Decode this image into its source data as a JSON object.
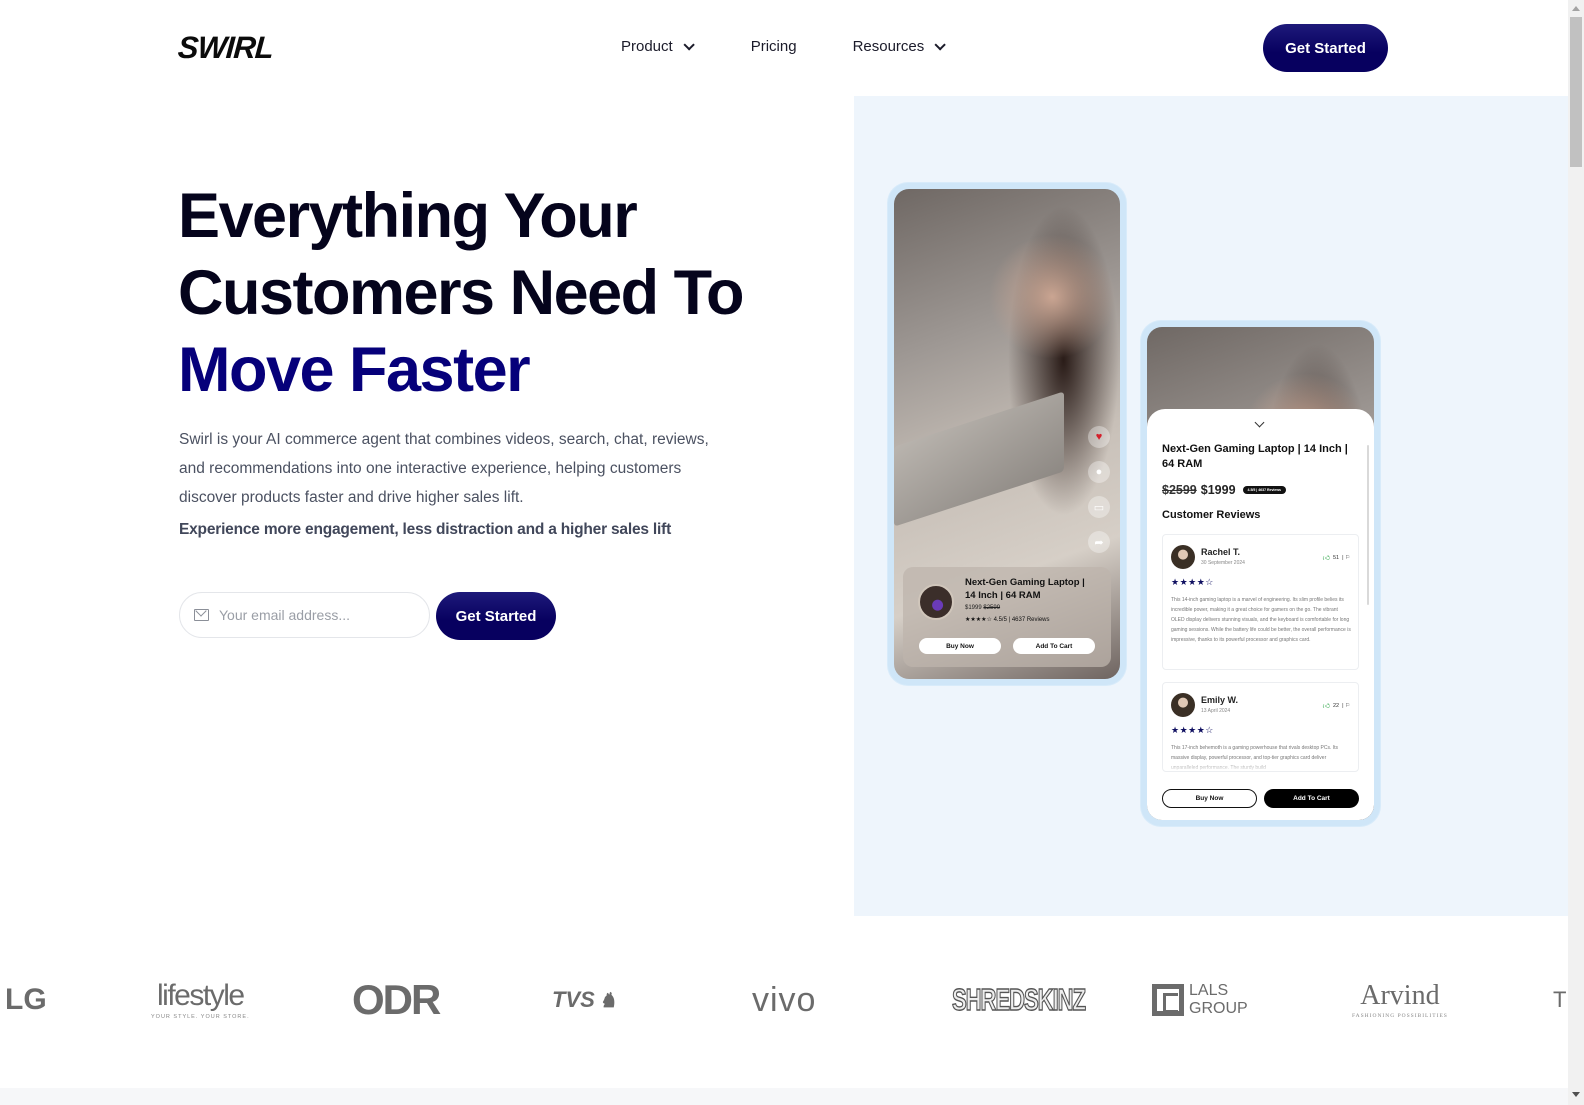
{
  "header": {
    "logo": "SWIRL",
    "nav": [
      {
        "label": "Product",
        "has_dropdown": true
      },
      {
        "label": "Pricing",
        "has_dropdown": false
      },
      {
        "label": "Resources",
        "has_dropdown": true
      }
    ],
    "cta_label": "Get Started"
  },
  "hero": {
    "title_line1": "Everything Your",
    "title_line2": "Customers Need To",
    "title_accent": "Move Faster",
    "description": "Swirl is your AI commerce agent that combines videos, search, chat, reviews, and recommendations into one interactive experience, helping customers discover products faster and drive higher sales lift.",
    "emphasis": "Experience more engagement, less distraction and a higher sales lift",
    "email_placeholder": "Your email address...",
    "email_value": "",
    "cta_label": "Get Started"
  },
  "video_phone": {
    "side_actions": [
      "heart-icon",
      "chat-icon",
      "bag-icon",
      "share-icon"
    ],
    "product": {
      "title": "Next-Gen Gaming Laptop | 14 Inch | 64 RAM",
      "price": "$1999",
      "old_price": "$2599",
      "stars": "★★★★☆",
      "rating_text": "4.5/5 | 4637 Reviews",
      "buy_label": "Buy Now",
      "cart_label": "Add To Cart"
    }
  },
  "review_phone": {
    "title": "Next-Gen Gaming Laptop | 14 Inch | 64 RAM",
    "old_price": "$2599",
    "price": "$1999",
    "rating_badge": "4.5/5 | 4637 Reviews",
    "section_title": "Customer Reviews",
    "reviews": [
      {
        "name": "Rachel T.",
        "date": "30 September 2024",
        "likes": "51",
        "stars": "★★★★☆",
        "text": "This 14-inch gaming laptop is a marvel of engineering. Its slim profile belies its incredible power, making it a great choice for gamers on the go. The vibrant OLED display delivers stunning visuals, and the keyboard is comfortable for long gaming sessions. While the battery life could be better, the overall performance is impressive, thanks to its powerful processor and graphics card."
      },
      {
        "name": "Emily W.",
        "date": "13 April 2024",
        "likes": "22",
        "stars": "★★★★☆",
        "text": "This 17-inch behemoth is a gaming powerhouse that rivals desktop PCs. Its massive display, powerful processor, and top-tier graphics card deliver unparalleled performance. The sturdy build"
      }
    ],
    "buy_label": "Buy Now",
    "cart_label": "Add To Cart"
  },
  "brands": [
    {
      "name": "LG"
    },
    {
      "name": "lifestyle",
      "tagline": "YOUR STYLE. YOUR STORE."
    },
    {
      "name": "ODR"
    },
    {
      "name": "TVS"
    },
    {
      "name": "vivo"
    },
    {
      "name": "SHREDSKINZ"
    },
    {
      "name": "LALS GROUP"
    },
    {
      "name": "Arvind",
      "tagline": "FASHIONING POSSIBILITIES"
    },
    {
      "name": "T"
    }
  ],
  "colors": {
    "brand_navy": "#07005f",
    "accent_title": "#06007a",
    "panel_bg": "#eef5fc"
  }
}
